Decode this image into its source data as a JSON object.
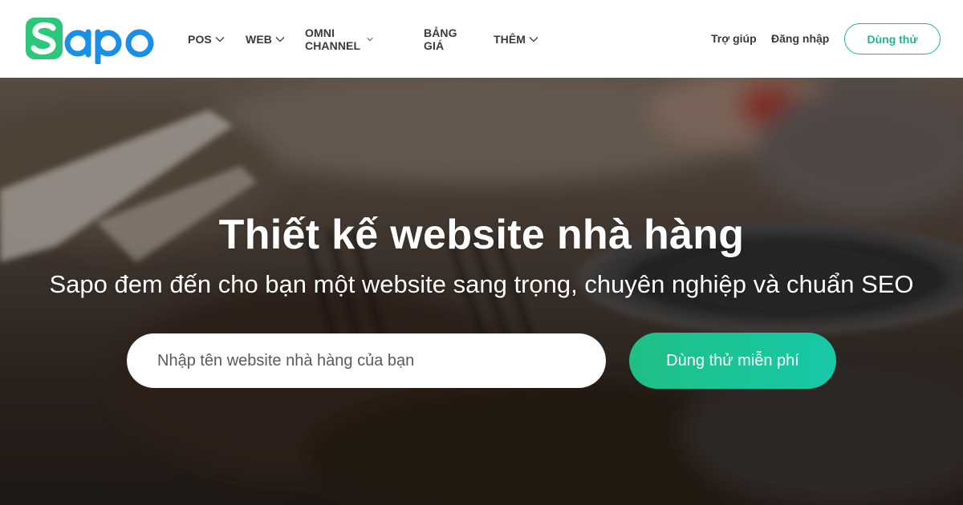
{
  "brand": {
    "name": "Sapo",
    "colors": {
      "logo_green": "#2bc77a",
      "logo_blue": "#1a8fe6",
      "accent": "#17b890"
    }
  },
  "nav": {
    "items": [
      {
        "label": "POS",
        "has_dropdown": true
      },
      {
        "label": "WEB",
        "has_dropdown": true
      },
      {
        "label": "OMNI CHANNEL",
        "has_dropdown": true
      },
      {
        "label": "BẢNG GIÁ",
        "has_dropdown": false
      },
      {
        "label": "THÊM",
        "has_dropdown": true
      }
    ],
    "help_label": "Trợ giúp",
    "login_label": "Đăng nhập",
    "trial_label": "Dùng thử"
  },
  "hero": {
    "title": "Thiết kế website nhà hàng",
    "subtitle": "Sapo đem đến cho bạn một website sang trọng, chuyên nghiệp và chuẩn SEO",
    "input_placeholder": "Nhập tên website nhà hàng của bạn",
    "input_value": "",
    "cta_label": "Dùng thử miễn phí"
  },
  "icons": [
    "chevron-down-icon"
  ]
}
